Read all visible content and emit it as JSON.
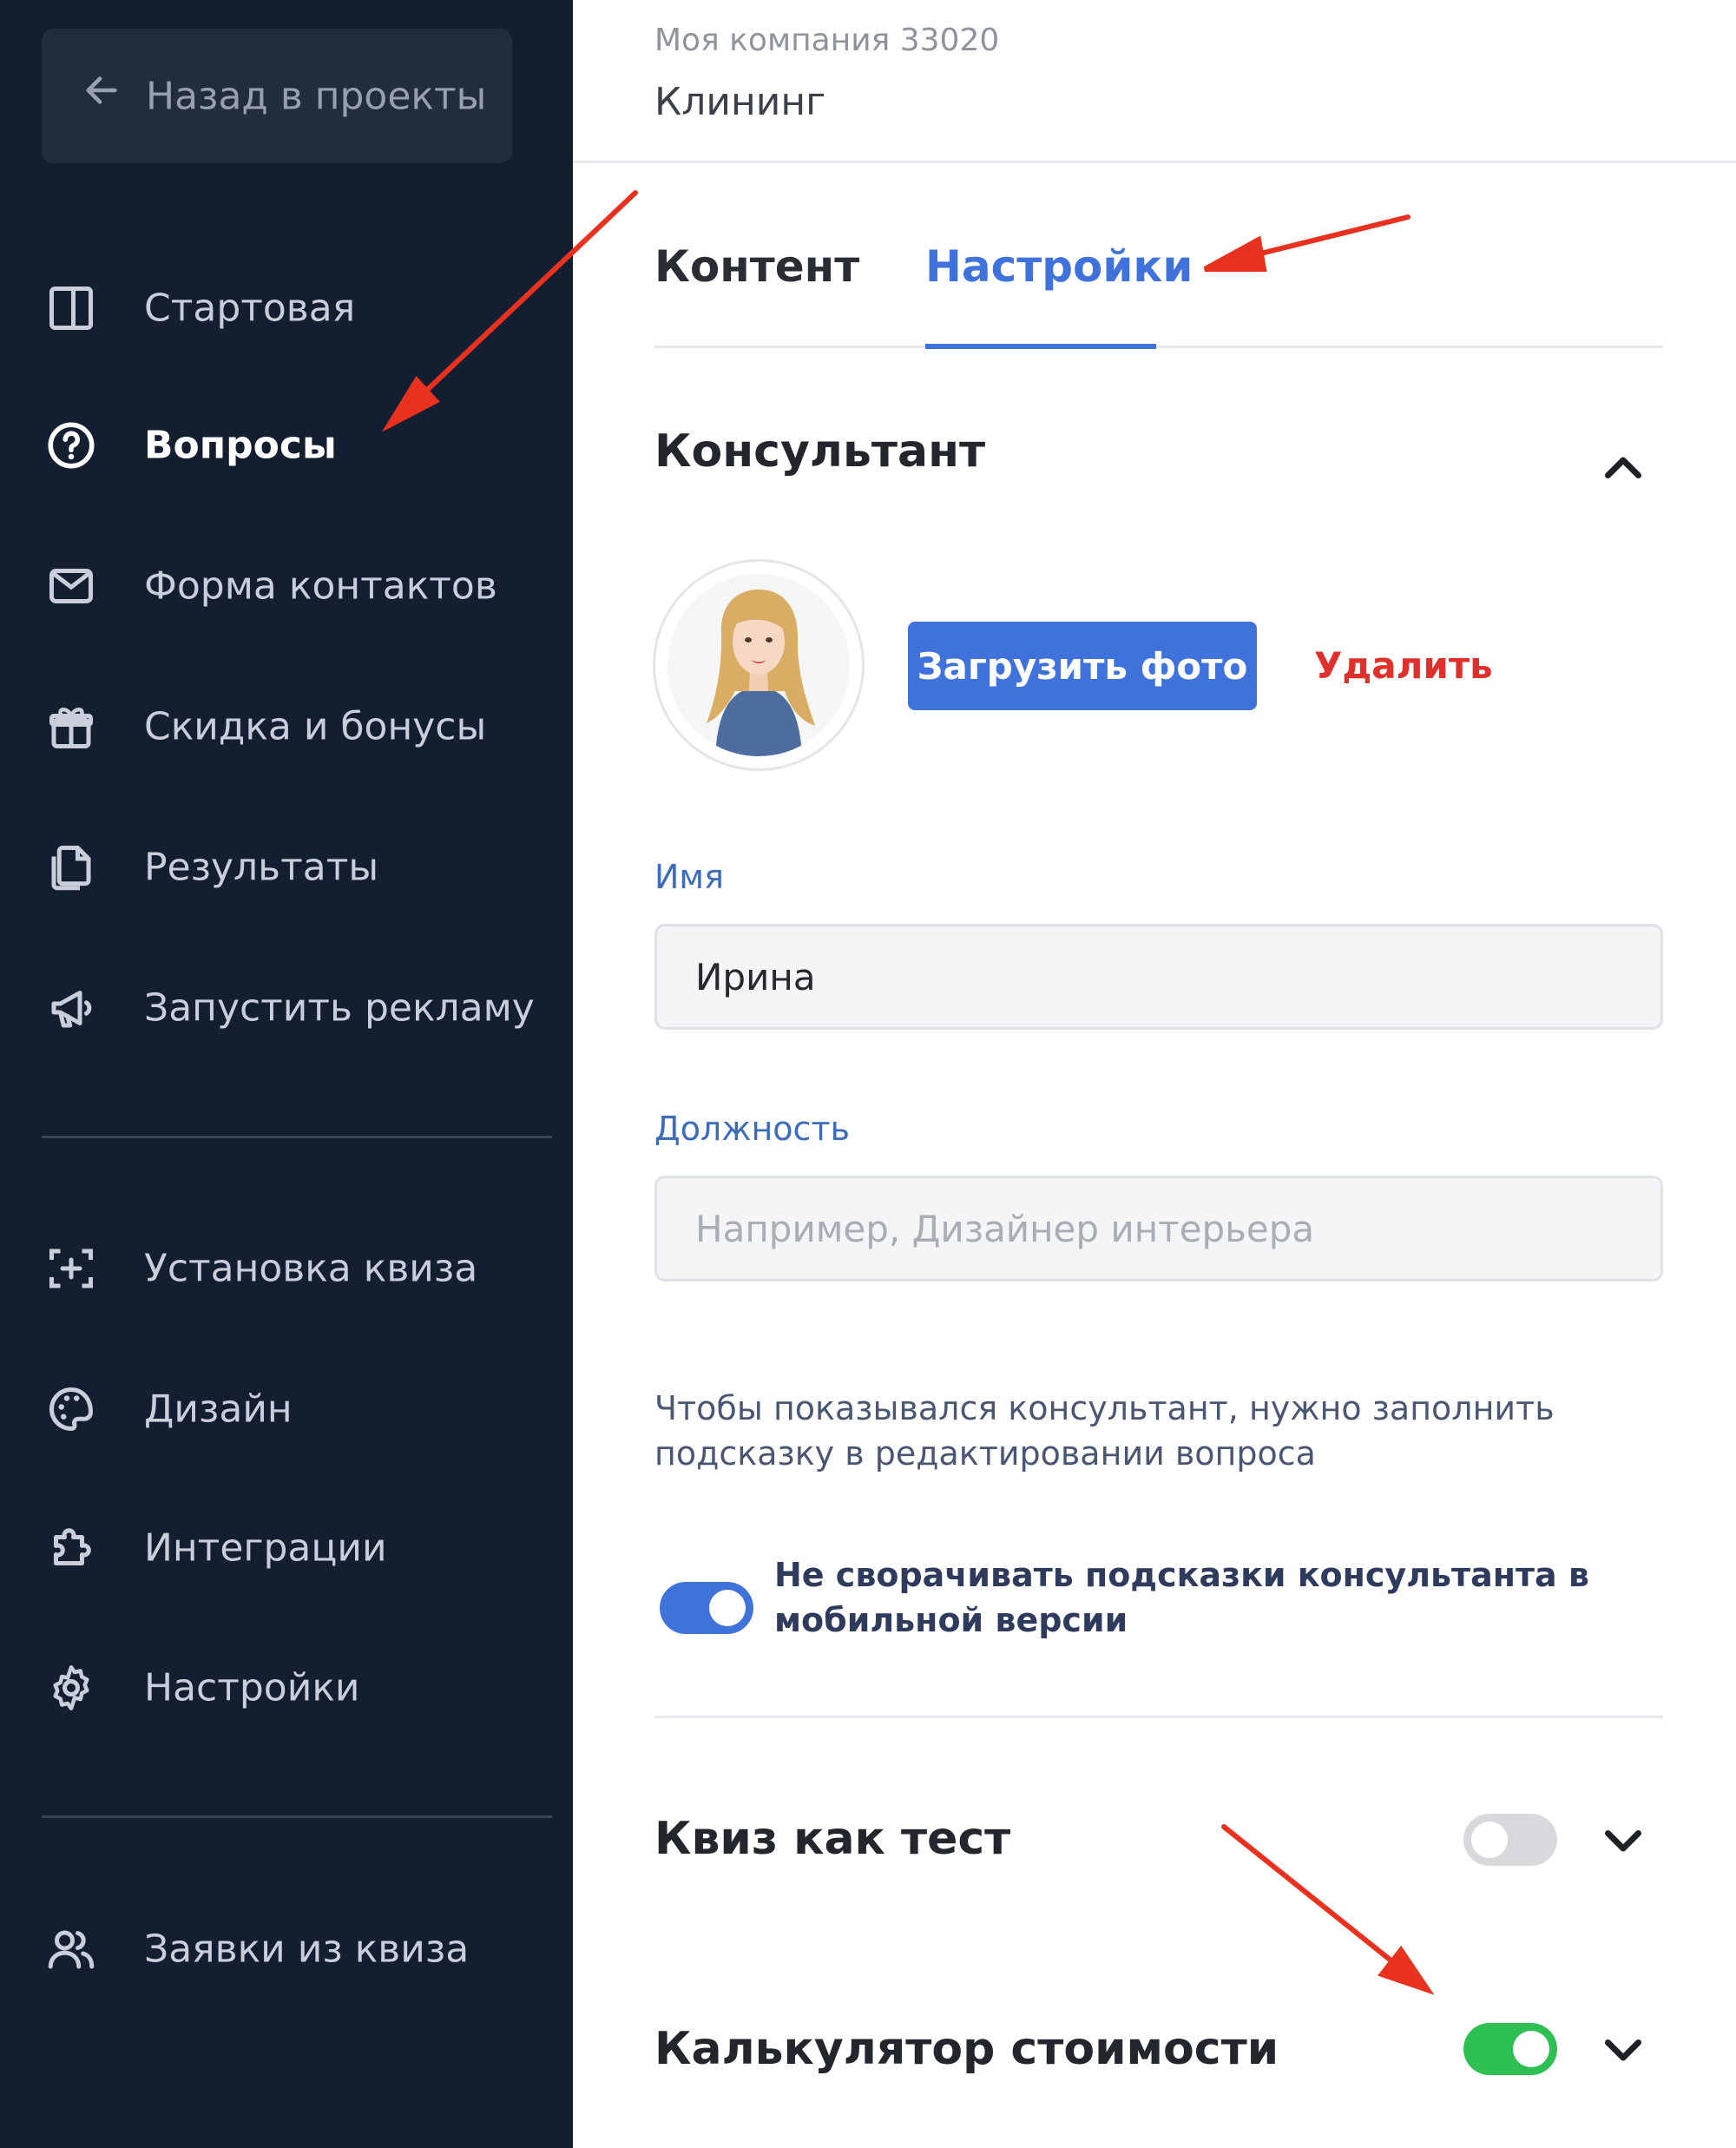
{
  "sidebar": {
    "back_label": "Назад в проекты",
    "items": [
      {
        "label": "Стартовая",
        "icon": "layout-icon"
      },
      {
        "label": "Вопросы",
        "icon": "question-circle-icon",
        "active": true
      },
      {
        "label": "Форма контактов",
        "icon": "mail-icon"
      },
      {
        "label": "Скидка и бонусы",
        "icon": "gift-icon"
      },
      {
        "label": "Результаты",
        "icon": "documents-icon"
      },
      {
        "label": "Запустить рекламу",
        "icon": "megaphone-icon"
      }
    ],
    "items2": [
      {
        "label": "Установка квиза",
        "icon": "add-frame-icon"
      },
      {
        "label": "Дизайн",
        "icon": "palette-icon"
      },
      {
        "label": "Интеграции",
        "icon": "puzzle-icon"
      },
      {
        "label": "Настройки",
        "icon": "gear-icon"
      }
    ],
    "items3": [
      {
        "label": "Заявки из квиза",
        "icon": "users-icon"
      }
    ]
  },
  "header": {
    "company": "Моя компания 33020",
    "project": "Клининг"
  },
  "tabs": {
    "content": "Контент",
    "settings": "Настройки",
    "active": "settings"
  },
  "consultant": {
    "title": "Консультант",
    "upload_label": "Загрузить фото",
    "delete_label": "Удалить",
    "name_label": "Имя",
    "name_value": "Ирина",
    "position_label": "Должность",
    "position_placeholder": "Например, Дизайнер интерьера",
    "hint": "Чтобы показывался консультант, нужно заполнить подсказку в редактировании вопроса",
    "toggle_label": "Не сворачивать подсказки консультанта в мобильной версии",
    "toggle_on": true
  },
  "sections": {
    "quiz_test": {
      "title": "Квиз как тест",
      "enabled": false
    },
    "calculator": {
      "title": "Калькулятор стоимости",
      "enabled": true
    }
  },
  "colors": {
    "sidebar_bg": "#141e31",
    "accent": "#3f72db",
    "danger": "#e0302b",
    "toggle_on_green": "#2ec052",
    "toggle_off": "#d7d9dd",
    "annotation_arrow": "#e8321f"
  }
}
